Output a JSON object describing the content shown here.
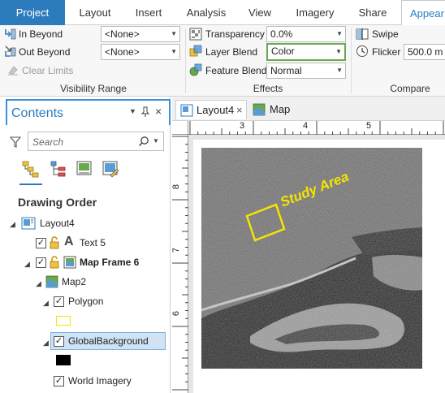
{
  "ribbon": {
    "tabs": [
      "Project",
      "Layout",
      "Insert",
      "Analysis",
      "View",
      "Imagery",
      "Share",
      "Appear"
    ],
    "visibility_range": {
      "in_beyond_label": "In Beyond",
      "in_beyond_value": "<None>",
      "out_beyond_label": "Out Beyond",
      "out_beyond_value": "<None>",
      "clear_limits_label": "Clear Limits",
      "group_title": "Visibility Range"
    },
    "effects": {
      "transparency_label": "Transparency",
      "transparency_value": "0.0%",
      "layer_blend_label": "Layer Blend",
      "layer_blend_value": "Color",
      "feature_blend_label": "Feature Blend",
      "feature_blend_value": "Normal",
      "group_title": "Effects"
    },
    "compare": {
      "swipe_label": "Swipe",
      "flicker_label": "Flicker",
      "flicker_value": "500.0 m",
      "group_title": "Compare"
    }
  },
  "contents": {
    "title": "Contents",
    "search_placeholder": "Search",
    "section_title": "Drawing Order",
    "items": [
      {
        "label": "Layout4"
      },
      {
        "label": "Text 5"
      },
      {
        "label": "Map Frame 6"
      },
      {
        "label": "Map2"
      },
      {
        "label": "Polygon"
      },
      {
        "label": "GlobalBackground"
      },
      {
        "label": "World Imagery"
      }
    ]
  },
  "view": {
    "tabs": [
      "Layout4",
      "Map"
    ],
    "ruler_h_ticks": [
      "3",
      "4",
      "5"
    ],
    "ruler_v_ticks": [
      "8",
      "7",
      "6"
    ],
    "map_annotation": "Study Area"
  },
  "colors": {
    "accent": "#2b7bbd",
    "highlight_border": "#6aa84f",
    "polygon_outline": "#f5e400"
  }
}
